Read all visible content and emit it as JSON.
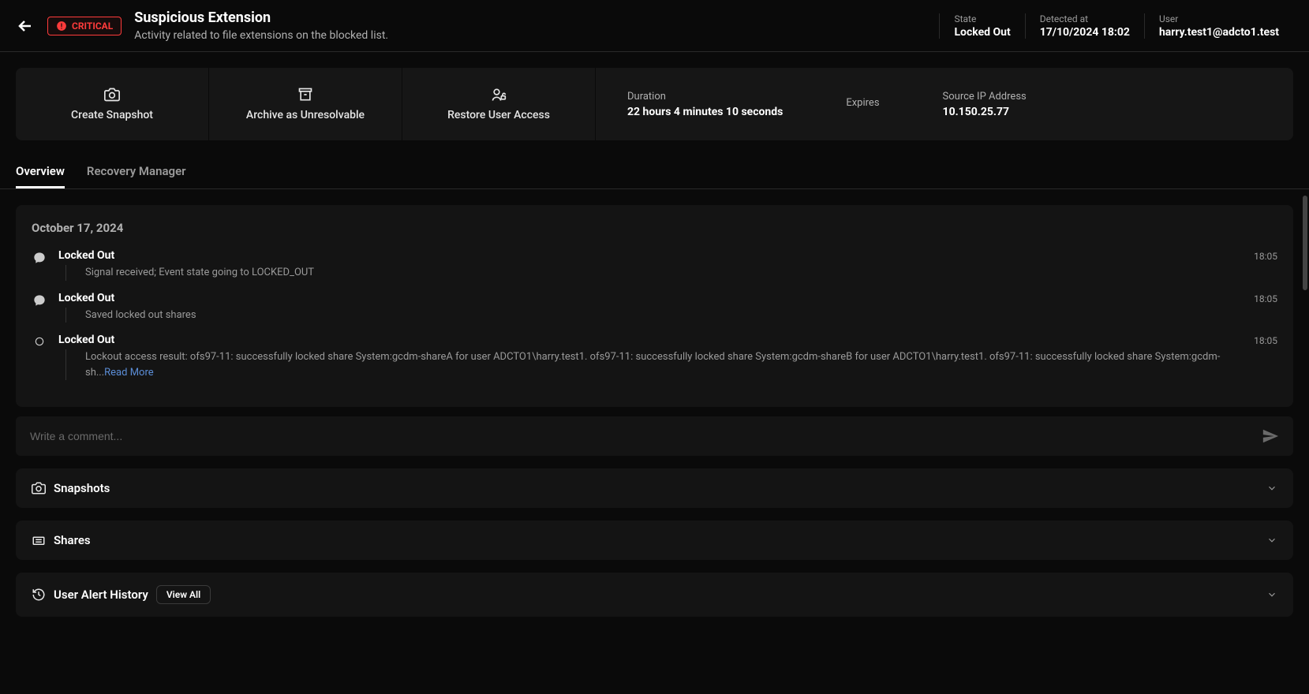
{
  "header": {
    "badge": "CRITICAL",
    "title": "Suspicious Extension",
    "subtitle": "Activity related to file extensions on the blocked list.",
    "meta": {
      "state_label": "State",
      "state_value": "Locked Out",
      "detected_label": "Detected at",
      "detected_value": "17/10/2024 18:02",
      "user_label": "User",
      "user_value": "harry.test1@adcto1.test"
    }
  },
  "actions": {
    "snapshot": "Create Snapshot",
    "archive": "Archive as Unresolvable",
    "restore": "Restore User Access"
  },
  "info": {
    "duration_label": "Duration",
    "duration_value": "22 hours 4 minutes 10 seconds",
    "expires_label": "Expires",
    "expires_value": "",
    "source_ip_label": "Source IP Address",
    "source_ip_value": "10.150.25.77"
  },
  "tabs": {
    "overview": "Overview",
    "recovery": "Recovery Manager"
  },
  "timeline": {
    "date": "October 17, 2024",
    "events": [
      {
        "title": "Locked Out",
        "desc": "Signal received; Event state going to LOCKED_OUT",
        "time": "18:05",
        "icon": "comment"
      },
      {
        "title": "Locked Out",
        "desc": "Saved locked out shares",
        "time": "18:05",
        "icon": "comment"
      },
      {
        "title": "Locked Out",
        "desc": "Lockout access result: ofs97-11: successfully locked share System:gcdm-shareA for user ADCTO1\\harry.test1. ofs97-11: successfully locked share System:gcdm-shareB for user ADCTO1\\harry.test1. ofs97-11: successfully locked share System:gcdm-sh...",
        "time": "18:05",
        "icon": "circle",
        "read_more": "Read More"
      }
    ]
  },
  "comment": {
    "placeholder": "Write a comment..."
  },
  "panels": {
    "snapshots": "Snapshots",
    "shares": "Shares",
    "alert_history": "User Alert History",
    "view_all": "View All"
  }
}
